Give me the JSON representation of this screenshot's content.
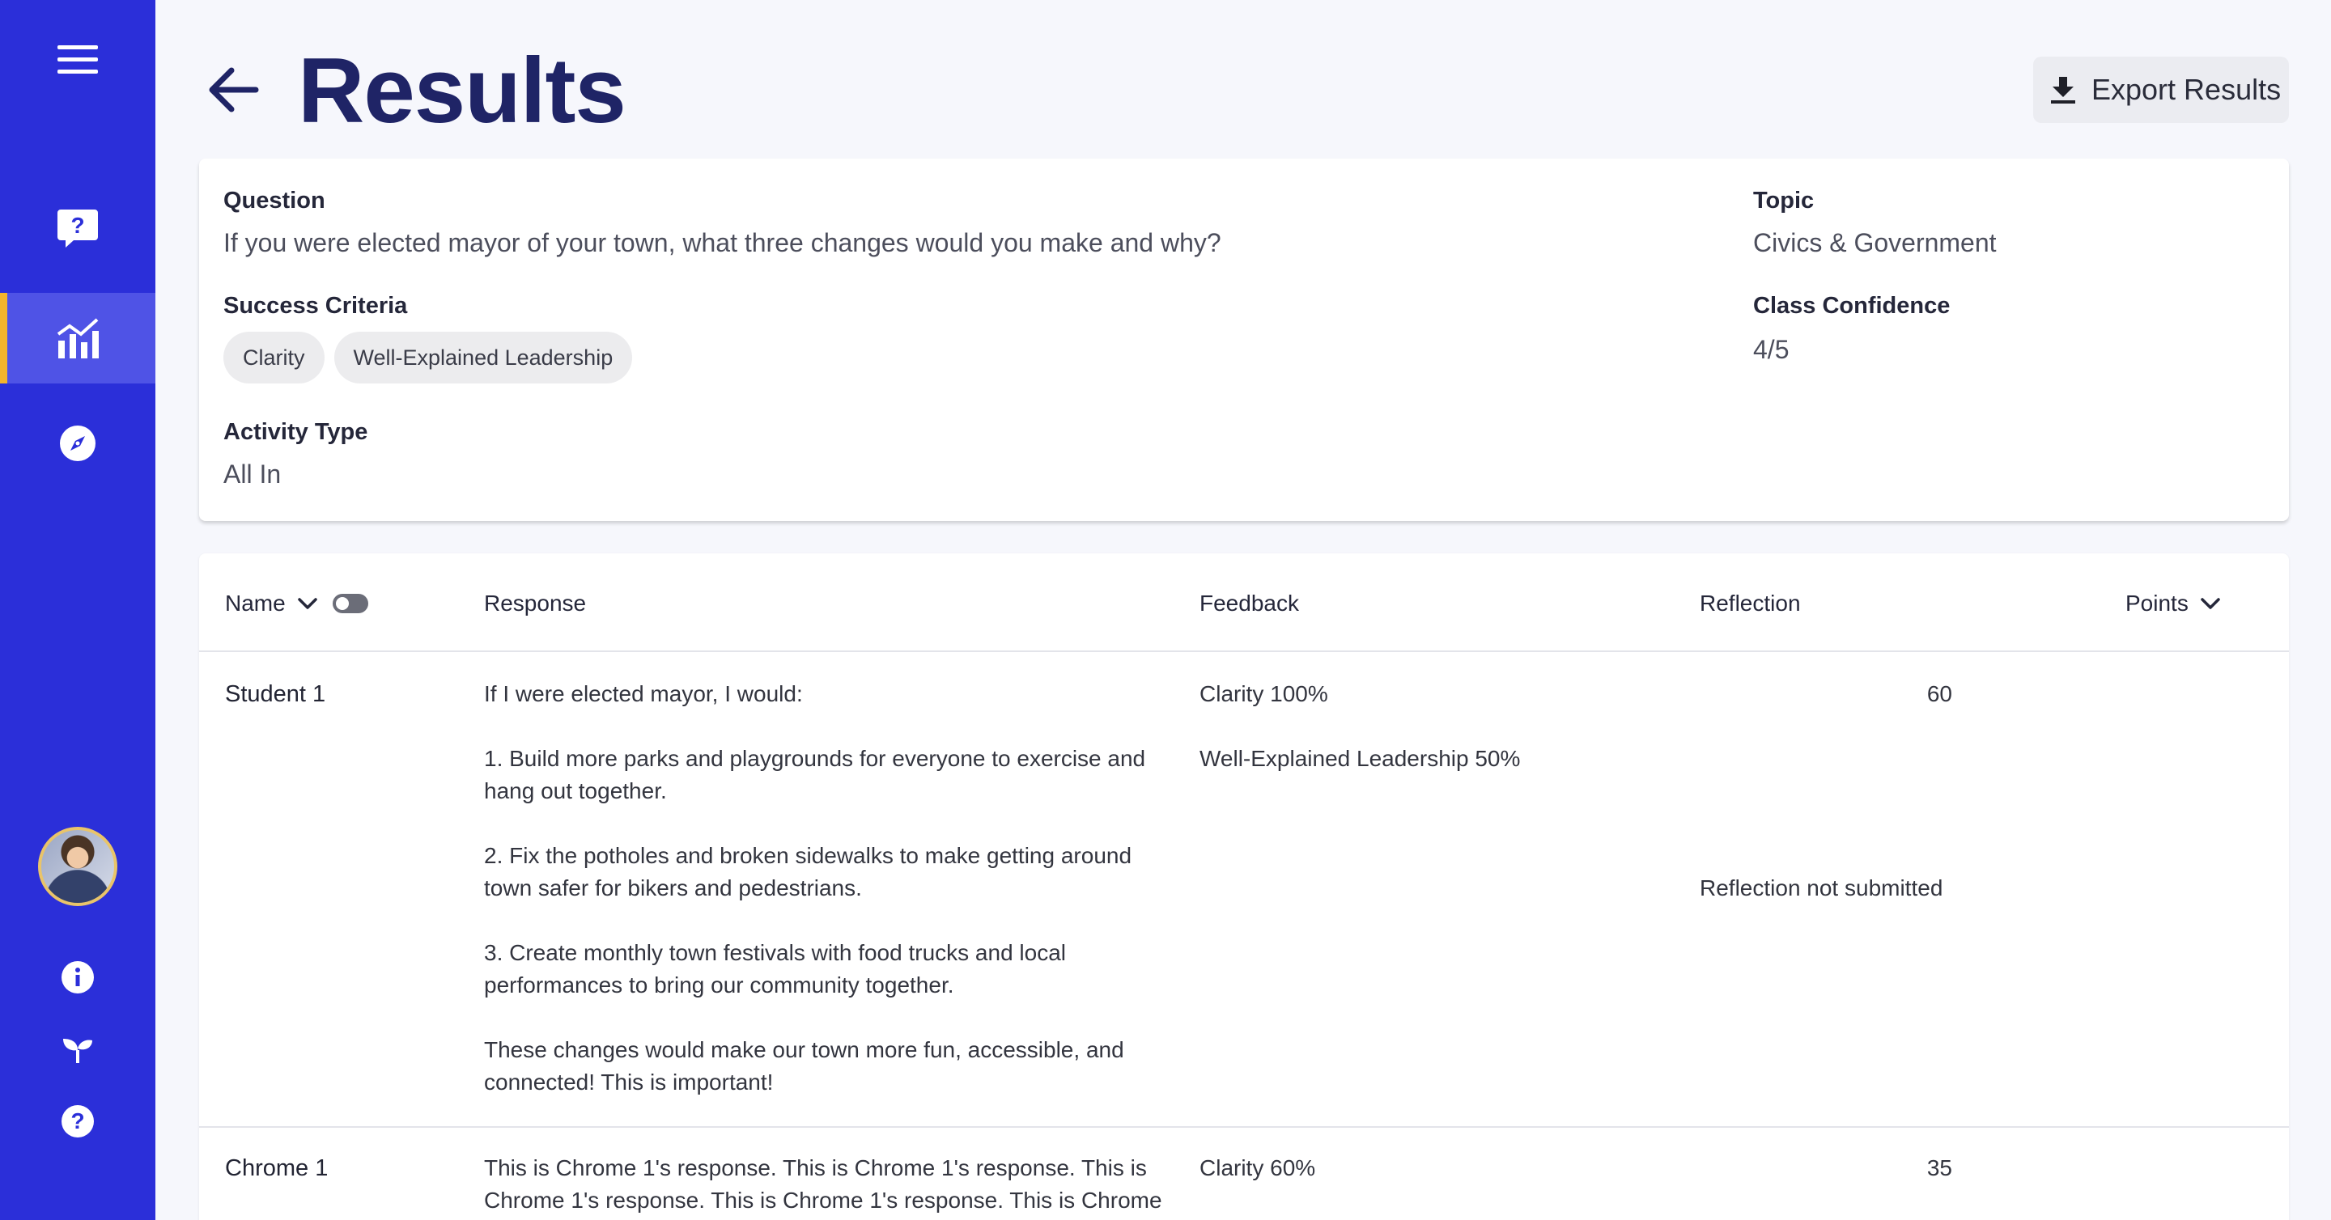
{
  "header": {
    "title": "Results",
    "export_label": "Export Results"
  },
  "sidebar": {
    "items": [
      {
        "name": "menu",
        "icon": "hamburger-icon"
      },
      {
        "name": "questions",
        "icon": "question-chat-icon"
      },
      {
        "name": "results",
        "icon": "chart-icon",
        "active": true
      },
      {
        "name": "explore",
        "icon": "compass-icon"
      },
      {
        "name": "profile",
        "icon": "avatar"
      },
      {
        "name": "info",
        "icon": "info-icon"
      },
      {
        "name": "growth",
        "icon": "sprout-icon"
      },
      {
        "name": "help",
        "icon": "help-icon"
      }
    ],
    "accent": "#2b2fd9",
    "active_marker": "#f4b42c"
  },
  "info": {
    "question_label": "Question",
    "question_value": "If you were elected mayor of your town, what three changes would you make and why?",
    "criteria_label": "Success Criteria",
    "criteria": [
      "Clarity",
      "Well-Explained Leadership"
    ],
    "activity_label": "Activity Type",
    "activity_value": "All In",
    "topic_label": "Topic",
    "topic_value": "Civics & Government",
    "confidence_label": "Class Confidence",
    "confidence_value": "4/5"
  },
  "table": {
    "columns": {
      "name": "Name",
      "response": "Response",
      "feedback": "Feedback",
      "reflection": "Reflection",
      "points": "Points"
    },
    "rows": [
      {
        "name": "Student 1",
        "response": [
          "If I were elected mayor, I would:",
          "1. Build more parks and playgrounds for everyone to exercise and hang out together.",
          "2. Fix the potholes and broken sidewalks to make getting around town safer for bikers and pedestrians.",
          "3. Create monthly town festivals with food trucks and local performances to bring our community together.",
          "These changes would make our town more fun, accessible, and connected! This is important!"
        ],
        "feedback": [
          "Clarity 100%",
          "Well-Explained Leadership 50%"
        ],
        "reflection": "Reflection not submitted",
        "points": "60"
      },
      {
        "name": "Chrome 1",
        "response": [
          "This is Chrome 1's response. This is Chrome 1's response. This is Chrome 1's response. This is Chrome 1's response. This is Chrome"
        ],
        "feedback": [
          "Clarity 60%"
        ],
        "reflection": "",
        "points": "35"
      }
    ]
  }
}
